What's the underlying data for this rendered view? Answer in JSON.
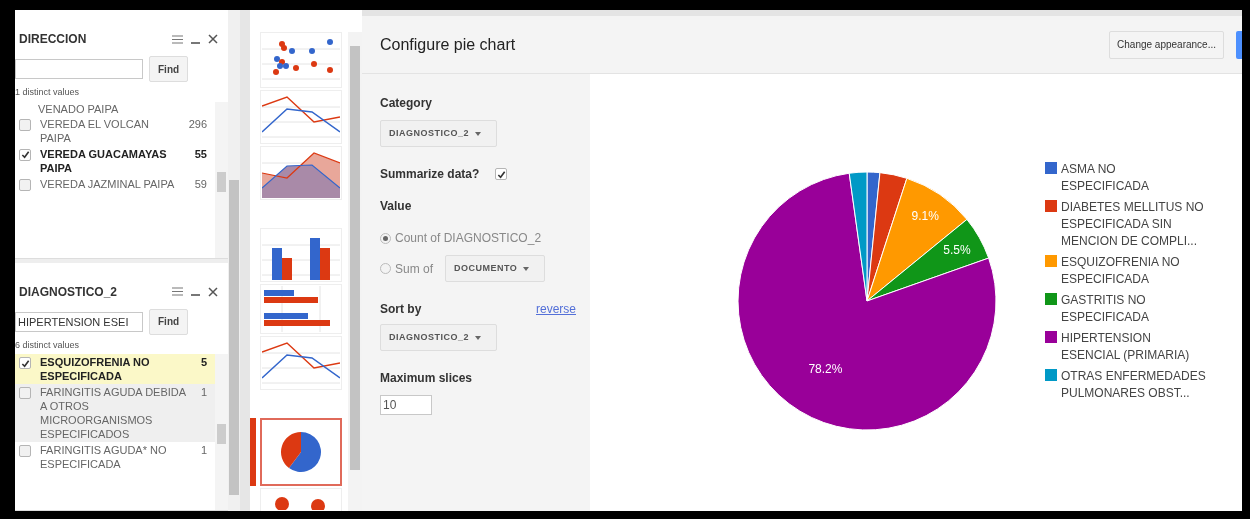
{
  "filters": [
    {
      "title": "DIRECCION",
      "find_button": "Find",
      "distinct": "1 distinct values",
      "items": [
        {
          "kind": "continuation",
          "label": "VENADO PAIPA"
        },
        {
          "kind": "value",
          "label": "VEREDA EL VOLCAN PAIPA",
          "count": "296",
          "checked": false,
          "selected": false,
          "hovered": false
        },
        {
          "kind": "value",
          "label": "VEREDA GUACAMAYAS PAIPA",
          "count": "55",
          "checked": true,
          "selected": false,
          "hovered": false
        },
        {
          "kind": "value",
          "label": "VEREDA JAZMINAL PAIPA",
          "count": "59",
          "checked": false,
          "selected": false,
          "hovered": false
        }
      ]
    },
    {
      "title": "DIAGNOSTICO_2",
      "search": {
        "value": "HIPERTENSION ESEI"
      },
      "find_button": "Find",
      "distinct": "6 distinct values",
      "items": [
        {
          "kind": "value",
          "label": "ESQUIZOFRENIA NO ESPECIFICADA",
          "count": "5",
          "checked": true,
          "selected": true,
          "hovered": false
        },
        {
          "kind": "value",
          "label": "FARINGITIS AGUDA DEBIDA A OTROS MICROORGANISMOS ESPECIFICADOS",
          "count": "1",
          "checked": false,
          "selected": false,
          "hovered": true
        },
        {
          "kind": "value",
          "label": "FARINGITIS AGUDA* NO ESPECIFICADA",
          "count": "1",
          "checked": false,
          "selected": false,
          "hovered": false
        }
      ]
    }
  ],
  "thumbnails": [
    {
      "kind": "scatter",
      "selected": false
    },
    {
      "kind": "line",
      "selected": false
    },
    {
      "kind": "area",
      "selected": false
    },
    {
      "kind": "column",
      "selected": false
    },
    {
      "kind": "bar",
      "selected": false
    },
    {
      "kind": "line",
      "selected": false
    },
    {
      "kind": "pie",
      "selected": true
    },
    {
      "kind": "bubble",
      "selected": false
    }
  ],
  "config": {
    "title": "Configure pie chart",
    "change_button": "Change appearance...",
    "category_label": "Category",
    "category_value": "DIAGNOSTICO_2",
    "summarize_label": "Summarize data?",
    "summarize_checked": true,
    "value_label": "Value",
    "value_options": [
      {
        "kind": "plain",
        "label": "Count of DIAGNOSTICO_2",
        "selected": true
      },
      {
        "kind": "dropdown",
        "label": "Sum of",
        "dropdown": "DOCUMENTO",
        "selected": false
      }
    ],
    "sort_label": "Sort by",
    "reverse_link": "reverse",
    "sort_value": "DIAGNOSTICO_2",
    "max_label": "Maximum slices",
    "max_value": "10"
  },
  "chart": {
    "chart_data": {
      "type": "pie",
      "categories": [
        "ASMA NO ESPECIFICADA",
        "DIABETES MELLITUS NO ESPECIFICADA SIN MENCION DE COMPLI...",
        "ESQUIZOFRENIA NO ESPECIFICADA",
        "GASTRITIS NO ESPECIFICADA",
        "HIPERTENSION ESENCIAL (PRIMARIA)",
        "OTRAS ENFERMEDADES PULMONARES OBST..."
      ],
      "series": [
        {
          "values": [
            1.6,
            3.4,
            9.1,
            5.5,
            78.2,
            2.2
          ]
        }
      ],
      "colors": [
        "#3366cc",
        "#dc3912",
        "#ff9900",
        "#109618",
        "#990099",
        "#0099c6"
      ],
      "value_labels": [
        null,
        null,
        "9.1%",
        "5.5%",
        "78.2%",
        null
      ]
    }
  }
}
